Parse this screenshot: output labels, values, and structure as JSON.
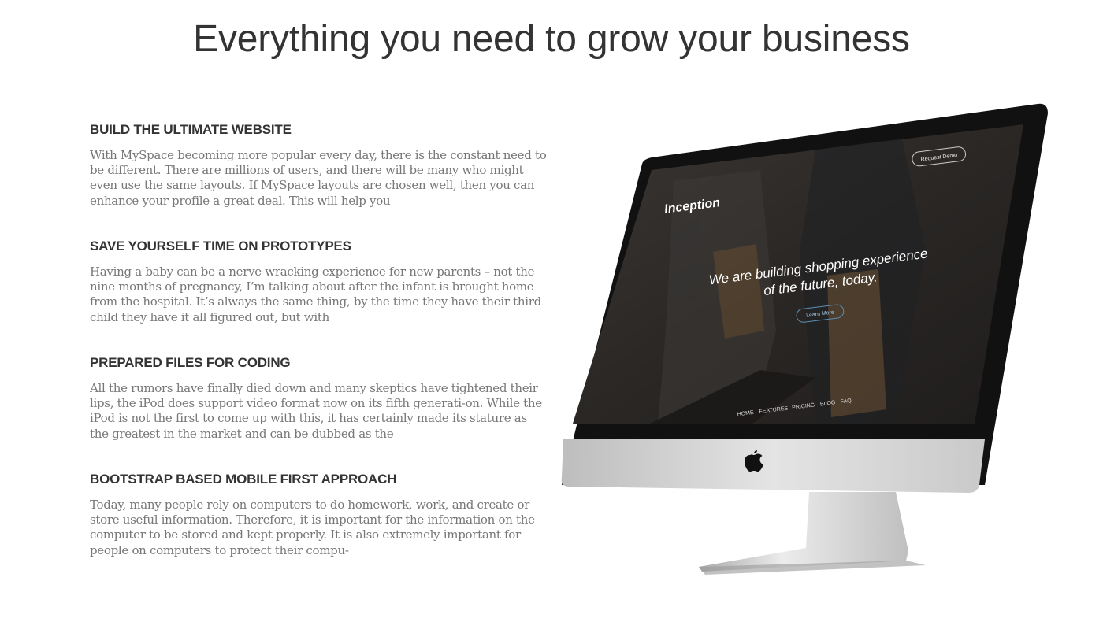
{
  "heading": "Everything you need to grow your business",
  "features": [
    {
      "title": "BUILD THE ULTIMATE WEBSITE",
      "text": "With MySpace becoming more popular every day, there is the constant need to be different. There are millions of users, and there will be many who might even use the same layouts. If MySpace layouts are chosen well, then you can enhance your profile a great deal. This will help you"
    },
    {
      "title": "SAVE YOURSELF TIME ON PROTOTYPES",
      "text": "Having a baby can be a nerve wracking experience for new parents – not the nine months of pregnancy, I’m talking about after the infant is brought home from the hospital. It’s always the same thing, by the time they have their third child they have it all figured out, but with"
    },
    {
      "title": "PREPARED FILES FOR CODING",
      "text": "All the rumors have finally died down and many skeptics have tightened their lips, the iPod does support video format now on its fifth generati-on. While the iPod is not the first to come up with this, it has certainly made its stature as the greatest in the market and can be dubbed as the"
    },
    {
      "title": "BOOTSTRAP BASED MOBILE FIRST APPROACH",
      "text": "Today, many people rely on computers to do homework, work, and create or store useful information. Therefore, it is important for the information on the computer to be stored and kept properly. It is also extremely important for people on computers to protect their compu-"
    }
  ],
  "screen": {
    "logo": "Inception",
    "request_demo": "Request Demo",
    "hero_line1": "We are building shopping experience",
    "hero_line2": "of the future, today.",
    "learn_more": "Learn More",
    "nav": [
      "HOME",
      "FEATURES",
      "PRICING",
      "BLOG",
      "FAQ"
    ]
  },
  "icons": {
    "brand": "apple-logo-icon"
  },
  "colors": {
    "heading": "#333333",
    "body_text": "#777777",
    "screen_bg": "#2a2826"
  }
}
